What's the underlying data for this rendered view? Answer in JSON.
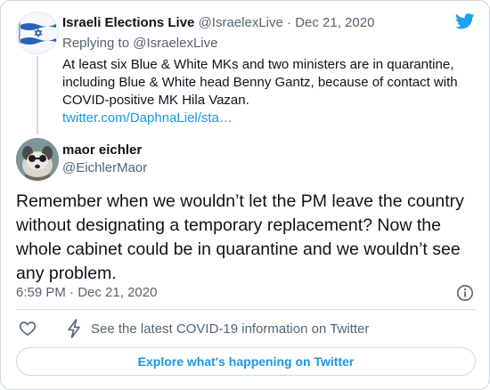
{
  "parent_tweet": {
    "display_name": "Israeli Elections Live",
    "handle": "@IsraelexLive",
    "separator": "·",
    "date": "Dec 21, 2020",
    "replying_to_label": "Replying to",
    "replying_to_handle": "@IsraelexLive",
    "text": "At least six Blue & White MKs and two ministers are in quarantine, including Blue & White head Benny Gantz, because of contact with COVID-positive MK Hila Vazan.",
    "link": "twitter.com/DaphnaLiel/sta…",
    "avatar_icon": "israel-flag-icon"
  },
  "main_tweet": {
    "display_name": "maor eichler",
    "handle": "@EichlerMaor",
    "avatar_icon": "dog-photo-avatar",
    "text": "Remember when we wouldn’t let the PM leave the country without designating a temporary replacement? Now the whole cabinet could be in quarantine and we wouldn’t see any problem.",
    "time": "6:59 PM",
    "separator": "·",
    "date": "Dec 21, 2020"
  },
  "actions": {
    "like_icon": "heart-icon",
    "covid_icon": "lightning-bolt-icon",
    "covid_text": "See the latest COVID-19 information on Twitter",
    "explore_label": "Explore what's happening on Twitter",
    "info_icon": "info-icon"
  },
  "brand": {
    "logo_icon": "twitter-bird-icon",
    "accent_color": "#1da1f2",
    "link_color": "#1b95e0"
  }
}
